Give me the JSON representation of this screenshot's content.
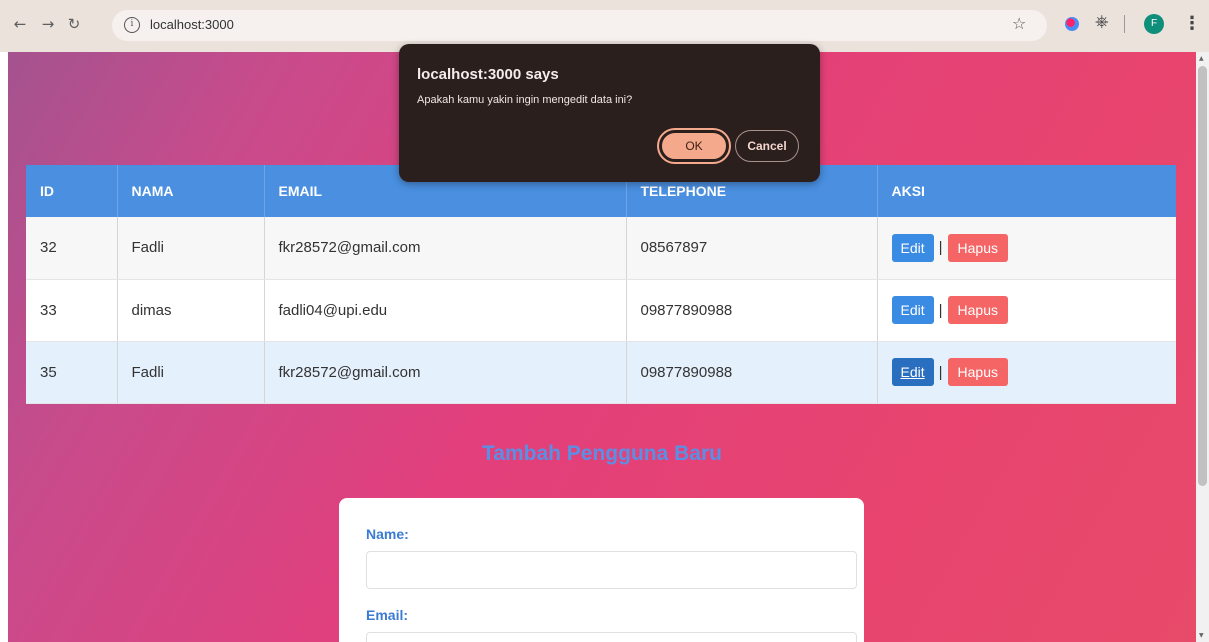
{
  "browser": {
    "url": "localhost:3000",
    "profile_initial": "F"
  },
  "dialog": {
    "title": "localhost:3000 says",
    "message": "Apakah kamu yakin ingin mengedit data ini?",
    "ok_label": "OK",
    "cancel_label": "Cancel"
  },
  "table": {
    "headers": [
      "ID",
      "NAMA",
      "EMAIL",
      "TELEPHONE",
      "AKSI"
    ],
    "rows": [
      {
        "id": "32",
        "nama": "Fadli",
        "email": "fkr28572@gmail.com",
        "telephone": "08567897"
      },
      {
        "id": "33",
        "nama": "dimas",
        "email": "fadli04@upi.edu",
        "telephone": "09877890988"
      },
      {
        "id": "35",
        "nama": "Fadli",
        "email": "fkr28572@gmail.com",
        "telephone": "09877890988"
      }
    ],
    "edit_label": "Edit",
    "separator": "|",
    "hapus_label": "Hapus"
  },
  "form": {
    "title": "Tambah Pengguna Baru",
    "name_label": "Name:",
    "email_label": "Email:"
  },
  "colors": {
    "header_bg": "#4a8fe0",
    "edit_btn": "#3a8be3",
    "hapus_btn": "#f56565",
    "dialog_bg": "#2b1f1e",
    "ok_btn": "#f4a98c"
  }
}
